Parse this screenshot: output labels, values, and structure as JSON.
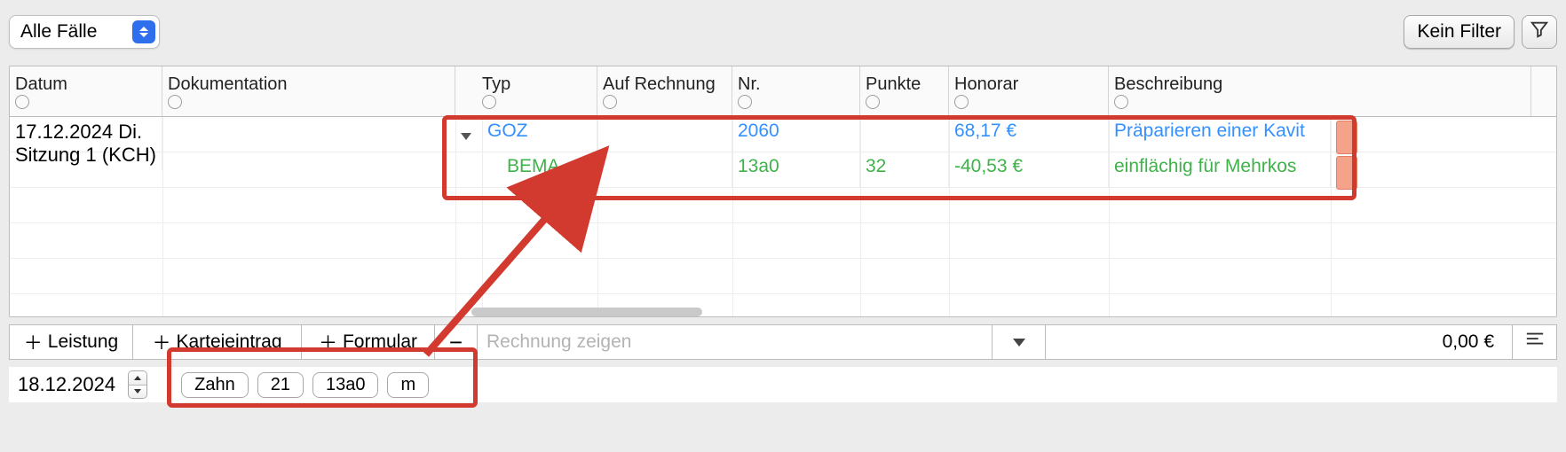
{
  "topbar": {
    "case_filter": "Alle Fälle",
    "no_filter_label": "Kein Filter"
  },
  "columns": {
    "date": "Datum",
    "doc": "Dokumentation",
    "type": "Typ",
    "invoice": "Auf Rechnung",
    "nr": "Nr.",
    "points": "Punkte",
    "fee": "Honorar",
    "desc": "Beschreibung"
  },
  "rows": [
    {
      "date_line1": "17.12.2024 Di.",
      "date_line2": "Sitzung 1 (KCH)",
      "kind": "section"
    },
    {
      "kind": "goz",
      "typ": "GOZ",
      "nr": "2060",
      "points": "",
      "fee": "68,17 €",
      "desc": "Präparieren einer Kavit"
    },
    {
      "kind": "bema",
      "typ": "BEMA",
      "nr": "13a0",
      "points": "32",
      "fee": "-40,53 €",
      "desc": "einflächig für Mehrkos"
    }
  ],
  "actionbar": {
    "add_service": "Leistung",
    "add_card": "Karteieintrag",
    "add_form": "Formular",
    "show_invoice": "Rechnung zeigen",
    "sum": "0,00 €"
  },
  "entry": {
    "date": "18.12.2024",
    "tags": [
      "Zahn",
      "21",
      "13a0",
      "m"
    ]
  }
}
